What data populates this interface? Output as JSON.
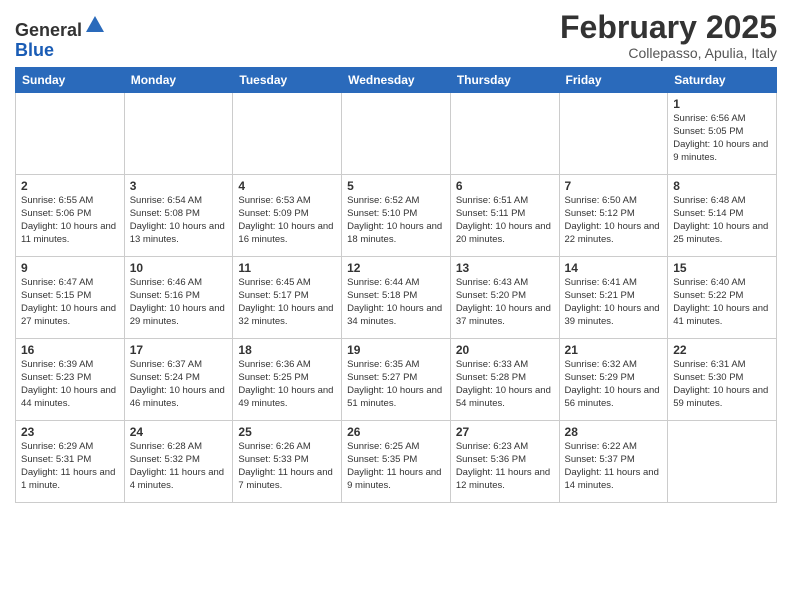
{
  "header": {
    "logo_general": "General",
    "logo_blue": "Blue",
    "month": "February 2025",
    "location": "Collepasso, Apulia, Italy"
  },
  "days_of_week": [
    "Sunday",
    "Monday",
    "Tuesday",
    "Wednesday",
    "Thursday",
    "Friday",
    "Saturday"
  ],
  "weeks": [
    [
      {
        "day": "",
        "info": ""
      },
      {
        "day": "",
        "info": ""
      },
      {
        "day": "",
        "info": ""
      },
      {
        "day": "",
        "info": ""
      },
      {
        "day": "",
        "info": ""
      },
      {
        "day": "",
        "info": ""
      },
      {
        "day": "1",
        "info": "Sunrise: 6:56 AM\nSunset: 5:05 PM\nDaylight: 10 hours and 9 minutes."
      }
    ],
    [
      {
        "day": "2",
        "info": "Sunrise: 6:55 AM\nSunset: 5:06 PM\nDaylight: 10 hours and 11 minutes."
      },
      {
        "day": "3",
        "info": "Sunrise: 6:54 AM\nSunset: 5:08 PM\nDaylight: 10 hours and 13 minutes."
      },
      {
        "day": "4",
        "info": "Sunrise: 6:53 AM\nSunset: 5:09 PM\nDaylight: 10 hours and 16 minutes."
      },
      {
        "day": "5",
        "info": "Sunrise: 6:52 AM\nSunset: 5:10 PM\nDaylight: 10 hours and 18 minutes."
      },
      {
        "day": "6",
        "info": "Sunrise: 6:51 AM\nSunset: 5:11 PM\nDaylight: 10 hours and 20 minutes."
      },
      {
        "day": "7",
        "info": "Sunrise: 6:50 AM\nSunset: 5:12 PM\nDaylight: 10 hours and 22 minutes."
      },
      {
        "day": "8",
        "info": "Sunrise: 6:48 AM\nSunset: 5:14 PM\nDaylight: 10 hours and 25 minutes."
      }
    ],
    [
      {
        "day": "9",
        "info": "Sunrise: 6:47 AM\nSunset: 5:15 PM\nDaylight: 10 hours and 27 minutes."
      },
      {
        "day": "10",
        "info": "Sunrise: 6:46 AM\nSunset: 5:16 PM\nDaylight: 10 hours and 29 minutes."
      },
      {
        "day": "11",
        "info": "Sunrise: 6:45 AM\nSunset: 5:17 PM\nDaylight: 10 hours and 32 minutes."
      },
      {
        "day": "12",
        "info": "Sunrise: 6:44 AM\nSunset: 5:18 PM\nDaylight: 10 hours and 34 minutes."
      },
      {
        "day": "13",
        "info": "Sunrise: 6:43 AM\nSunset: 5:20 PM\nDaylight: 10 hours and 37 minutes."
      },
      {
        "day": "14",
        "info": "Sunrise: 6:41 AM\nSunset: 5:21 PM\nDaylight: 10 hours and 39 minutes."
      },
      {
        "day": "15",
        "info": "Sunrise: 6:40 AM\nSunset: 5:22 PM\nDaylight: 10 hours and 41 minutes."
      }
    ],
    [
      {
        "day": "16",
        "info": "Sunrise: 6:39 AM\nSunset: 5:23 PM\nDaylight: 10 hours and 44 minutes."
      },
      {
        "day": "17",
        "info": "Sunrise: 6:37 AM\nSunset: 5:24 PM\nDaylight: 10 hours and 46 minutes."
      },
      {
        "day": "18",
        "info": "Sunrise: 6:36 AM\nSunset: 5:25 PM\nDaylight: 10 hours and 49 minutes."
      },
      {
        "day": "19",
        "info": "Sunrise: 6:35 AM\nSunset: 5:27 PM\nDaylight: 10 hours and 51 minutes."
      },
      {
        "day": "20",
        "info": "Sunrise: 6:33 AM\nSunset: 5:28 PM\nDaylight: 10 hours and 54 minutes."
      },
      {
        "day": "21",
        "info": "Sunrise: 6:32 AM\nSunset: 5:29 PM\nDaylight: 10 hours and 56 minutes."
      },
      {
        "day": "22",
        "info": "Sunrise: 6:31 AM\nSunset: 5:30 PM\nDaylight: 10 hours and 59 minutes."
      }
    ],
    [
      {
        "day": "23",
        "info": "Sunrise: 6:29 AM\nSunset: 5:31 PM\nDaylight: 11 hours and 1 minute."
      },
      {
        "day": "24",
        "info": "Sunrise: 6:28 AM\nSunset: 5:32 PM\nDaylight: 11 hours and 4 minutes."
      },
      {
        "day": "25",
        "info": "Sunrise: 6:26 AM\nSunset: 5:33 PM\nDaylight: 11 hours and 7 minutes."
      },
      {
        "day": "26",
        "info": "Sunrise: 6:25 AM\nSunset: 5:35 PM\nDaylight: 11 hours and 9 minutes."
      },
      {
        "day": "27",
        "info": "Sunrise: 6:23 AM\nSunset: 5:36 PM\nDaylight: 11 hours and 12 minutes."
      },
      {
        "day": "28",
        "info": "Sunrise: 6:22 AM\nSunset: 5:37 PM\nDaylight: 11 hours and 14 minutes."
      },
      {
        "day": "",
        "info": ""
      }
    ]
  ]
}
